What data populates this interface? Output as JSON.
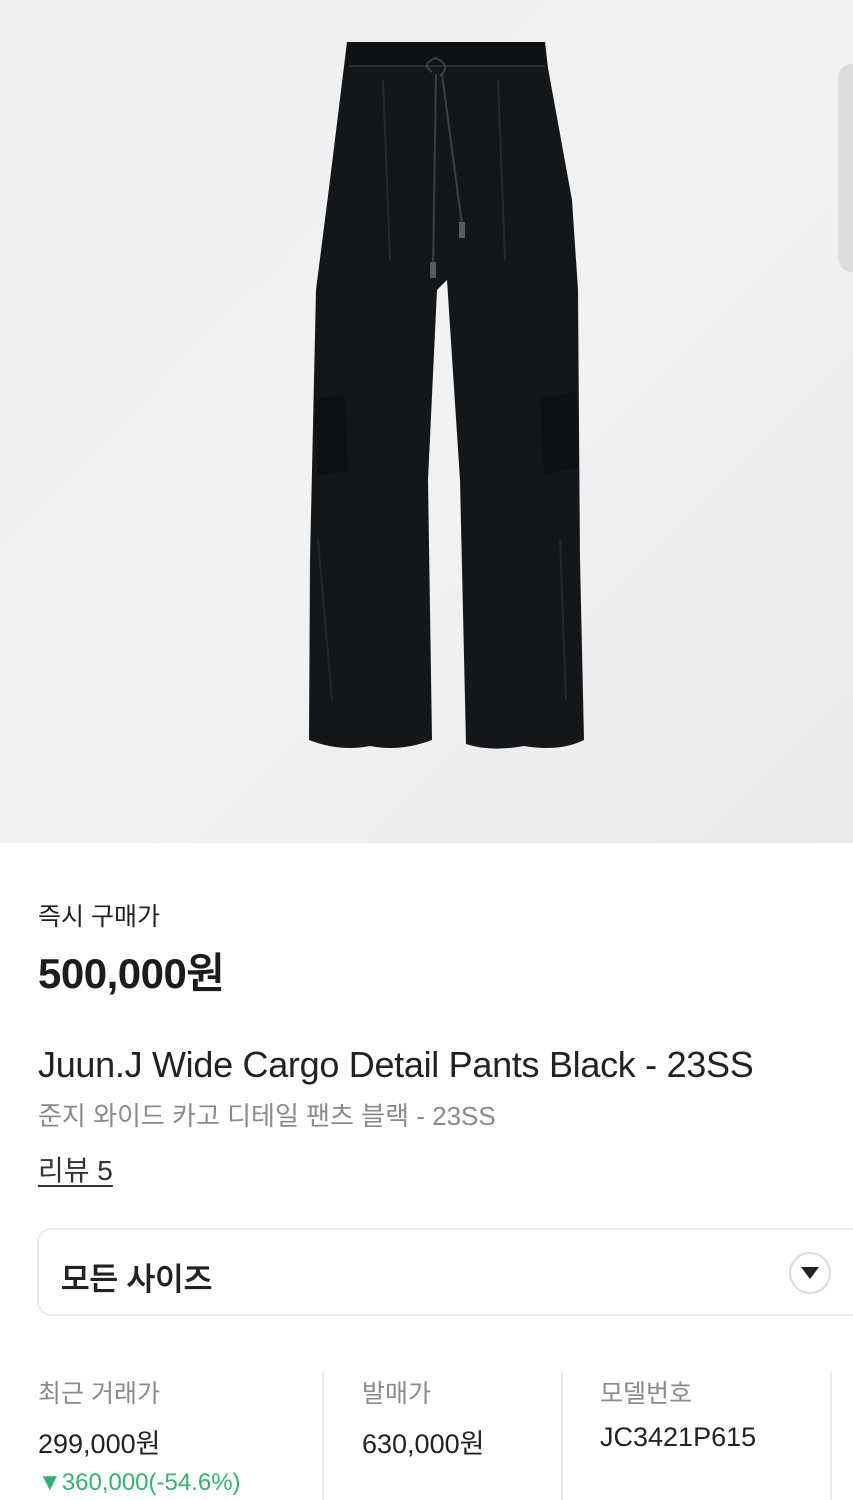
{
  "product": {
    "instant_buy_label": "즉시 구매가",
    "instant_buy_price": "500,000원",
    "title_en": "Juun.J Wide Cargo Detail Pants Black - 23SS",
    "title_ko": "준지 와이드 카고 디테일 팬츠 블랙 - 23SS",
    "review_link": "리뷰 5"
  },
  "size_selector": {
    "label": "모든 사이즈",
    "icon": "chevron-down-icon"
  },
  "info": {
    "recent_trade": {
      "label": "최근 거래가",
      "value": "299,000원",
      "change": "▼360,000(-54.6%)"
    },
    "release_price": {
      "label": "발매가",
      "value": "630,000원"
    },
    "model_number": {
      "label": "모델번호",
      "value": "JC3421P615"
    }
  },
  "colors": {
    "price_down": "#31b46e",
    "product_black": "#14171a"
  }
}
